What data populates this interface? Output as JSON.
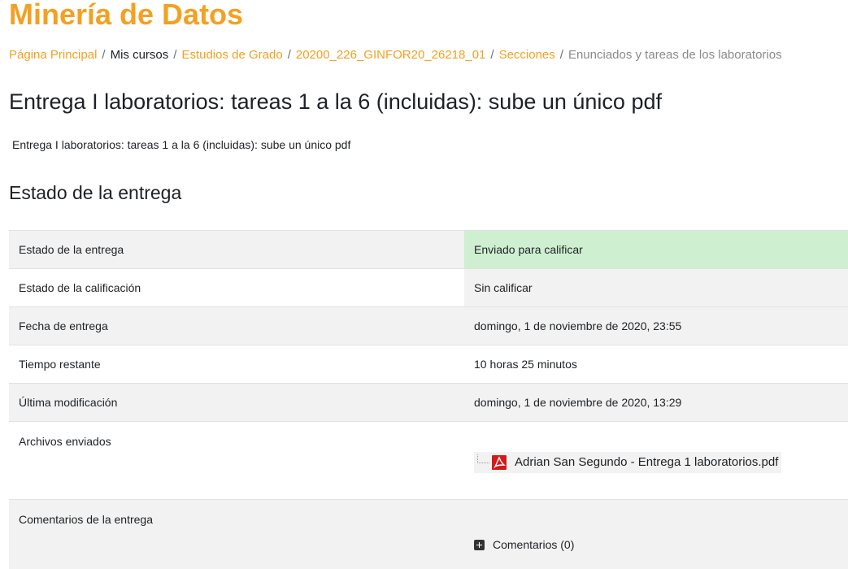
{
  "course": {
    "title": "Minería de Datos"
  },
  "breadcrumb": {
    "items": [
      {
        "label": "Página Principal",
        "type": "link"
      },
      {
        "label": "Mis cursos",
        "type": "plain"
      },
      {
        "label": "Estudios de Grado",
        "type": "link"
      },
      {
        "label": "20200_226_GINFOR20_26218_01",
        "type": "link"
      },
      {
        "label": "Secciones",
        "type": "link"
      },
      {
        "label": "Enunciados y tareas de los laboratorios",
        "type": "current"
      }
    ],
    "separator": "/"
  },
  "assignment": {
    "title": "Entrega I laboratorios: tareas 1 a la 6 (incluidas): sube un único pdf",
    "intro": "Entrega I laboratorios: tareas 1 a la 6 (incluidas): sube un único pdf"
  },
  "submission_status": {
    "heading": "Estado de la entrega",
    "rows": [
      {
        "label": "Estado de la entrega",
        "value": "Enviado para calificar"
      },
      {
        "label": "Estado de la calificación",
        "value": "Sin calificar"
      },
      {
        "label": "Fecha de entrega",
        "value": "domingo, 1 de noviembre de 2020, 23:55"
      },
      {
        "label": "Tiempo restante",
        "value": "10 horas 25 minutos"
      },
      {
        "label": "Última modificación",
        "value": "domingo, 1 de noviembre de 2020, 13:29"
      },
      {
        "label": "Archivos enviados",
        "file": "Adrian San Segundo - Entrega 1 laboratorios.pdf",
        "icon": "pdf-icon"
      },
      {
        "label": "Comentarios de la entrega",
        "comments_link": "Comentarios (0)",
        "icon": "plus-icon"
      }
    ]
  },
  "colors": {
    "accent": "#f4a021",
    "submitted_bg": "#cfefd1",
    "row_shade": "#f2f2f2"
  }
}
